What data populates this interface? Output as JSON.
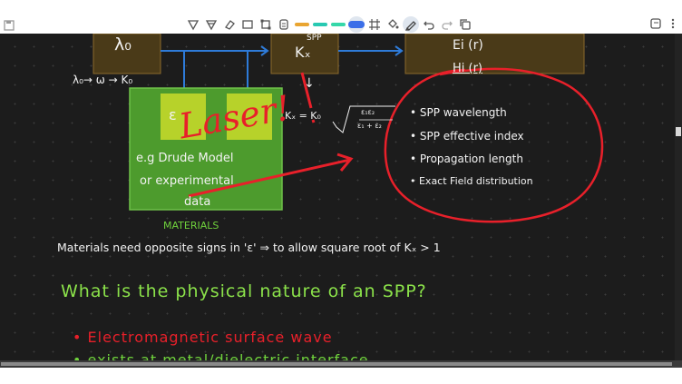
{
  "toolbar": {
    "tools": [
      "lasso-icon",
      "lasso-alt-icon",
      "eraser-icon",
      "shape-icon",
      "select-rect-icon",
      "text-tool-icon"
    ],
    "pens": [
      {
        "color": "#e9a531",
        "selected": false
      },
      {
        "color": "#28c9b2",
        "selected": false
      },
      {
        "color": "#35d8a9",
        "selected": false
      },
      {
        "color": "#3a6ee8",
        "selected": true
      }
    ],
    "right_tools": [
      "grid-icon",
      "paint-bucket-icon",
      "pen-icon",
      "undo-icon",
      "redo-icon",
      "copy-icon"
    ],
    "menu_icon": "more-vertical-icon"
  },
  "notes": {
    "lambda0": "λ₀",
    "kx_spp": "Kₓ",
    "spp_label": "SPP",
    "ei_label": "Ei (r)",
    "hi_label": "Hi (r)",
    "lambda_chain": "λ₀→ ω → K₀",
    "down_arrow": "↓",
    "materials_box": "ε",
    "drude_line1": "e.g Drude Model",
    "drude_line2": "or experimental",
    "drude_line3": "data",
    "materials_label": "MATERIALS",
    "kx_formula": "Kₓ = K₀",
    "formula_top": "ε₁ε₂",
    "formula_bottom": "ε₁ + ε₂",
    "laser": "Laser!",
    "bullets": [
      "• SPP wavelength",
      "• SPP effective index",
      "• Propagation length",
      "• Exact Field distribution"
    ],
    "materials_note": "Materials need opposite signs in 'ε' ⇒ to allow square root of Kₓ > 1",
    "question": "What is the physical nature of an SPP?",
    "point1": "• Electromagnetic surface wave",
    "point2": "• exists at metal/dielectric interface"
  }
}
